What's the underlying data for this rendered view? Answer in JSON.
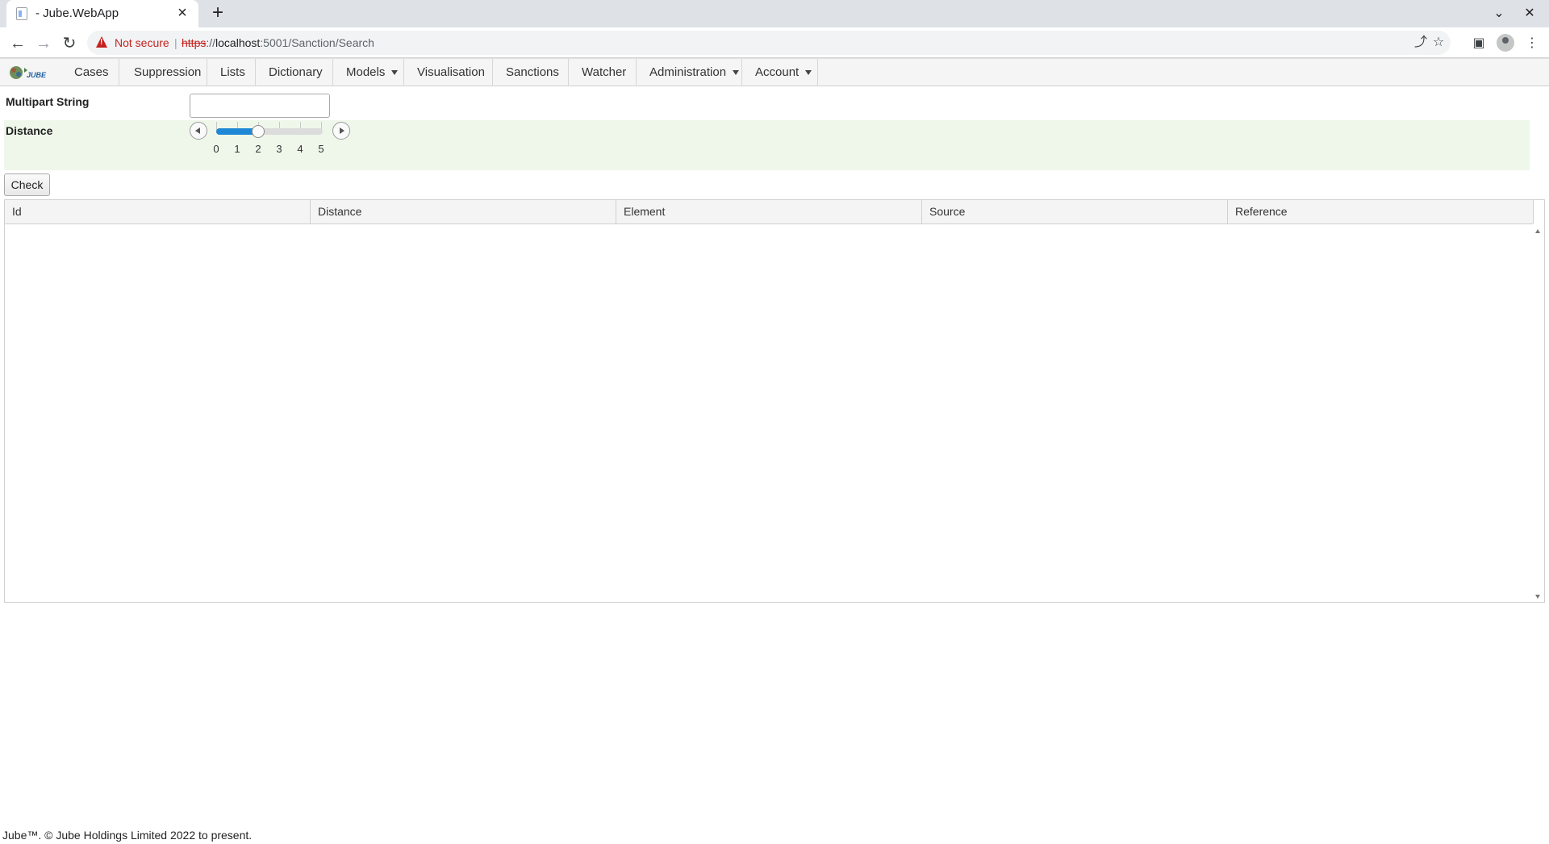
{
  "browser": {
    "tab_title": "- Jube.WebApp",
    "new_tab_symbol": "+",
    "security_label": "Not secure",
    "url_scheme": "https",
    "url_sep": "://",
    "url_host": "localhost",
    "url_rest": ":5001/Sanction/Search"
  },
  "menu": {
    "items": [
      {
        "label": "Cases"
      },
      {
        "label": "Suppression"
      },
      {
        "label": "Lists"
      },
      {
        "label": "Dictionary"
      },
      {
        "label": "Models",
        "dropdown": true
      },
      {
        "label": "Visualisation"
      },
      {
        "label": "Sanctions"
      },
      {
        "label": "Watcher"
      },
      {
        "label": "Administration",
        "dropdown": true
      },
      {
        "label": "Account",
        "dropdown": true
      }
    ]
  },
  "form": {
    "multipart_label": "Multipart String",
    "multipart_value": "",
    "distance_label": "Distance",
    "distance": {
      "min": 0,
      "max": 5,
      "value": 2,
      "ticks": [
        "0",
        "1",
        "2",
        "3",
        "4",
        "5"
      ]
    },
    "check_label": "Check"
  },
  "grid": {
    "columns": [
      "Id",
      "Distance",
      "Element",
      "Source",
      "Reference"
    ],
    "rows": []
  },
  "footer": {
    "text": "Jube™. © Jube Holdings Limited 2022 to present."
  },
  "colors": {
    "slider_fill": "#1e88d6",
    "distance_row_bg": "#eef7ea",
    "not_secure": "#c5221f"
  }
}
